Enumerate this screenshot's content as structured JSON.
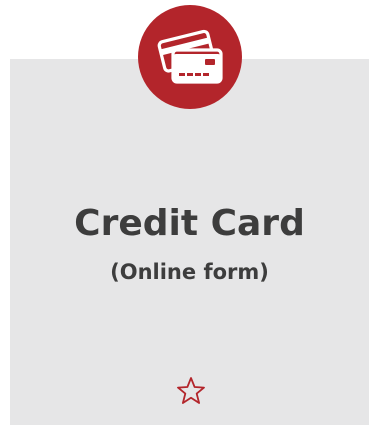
{
  "card": {
    "title": "Credit Card",
    "subtitle": "(Online form)",
    "icon": "credit-cards-icon",
    "favorite_icon": "star-outline-icon"
  },
  "colors": {
    "accent": "#b3252b",
    "tile_background": "#e6e6e7",
    "text": "#3d3d3d"
  }
}
